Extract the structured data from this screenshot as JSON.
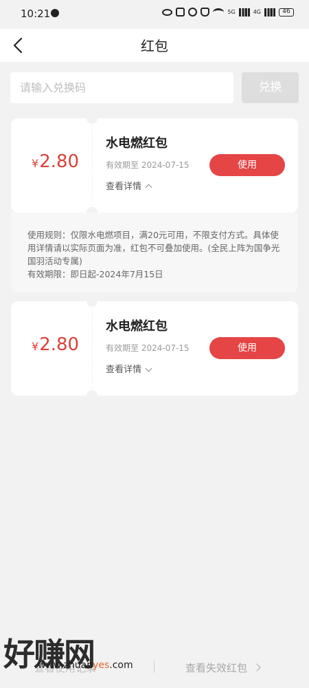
{
  "status_bar": {
    "time": "10:21",
    "network_1": "5G",
    "network_2": "4G",
    "battery": "46"
  },
  "nav": {
    "title": "红包"
  },
  "redeem": {
    "placeholder": "请输入兑换码",
    "button_label": "兑换"
  },
  "coupons": [
    {
      "currency": "¥",
      "amount": "2.80",
      "title": "水电燃红包",
      "expiry": "有效期至 2024-07-15",
      "details_label": "查看详情",
      "use_label": "使用",
      "expanded": true
    },
    {
      "currency": "¥",
      "amount": "2.80",
      "title": "水电燃红包",
      "expiry": "有效期至 2024-07-15",
      "details_label": "查看详情",
      "use_label": "使用",
      "expanded": false
    }
  ],
  "rules": {
    "text": "使用规则：仅限水电燃项目，满20元可用，不限支付方式。具体使用详情请以实际页面为准，红包不可叠加使用。(全民上阵为国争光国羽活动专属)",
    "validity": "有效期限：即日起-2024年7月15日"
  },
  "bottom": {
    "history_label": "查看使用记录",
    "expired_label": "查看失效红包"
  },
  "watermark": {
    "big_text": "好赚网",
    "url_prefix": "www.zhuan",
    "url_accent": "yes",
    "url_suffix": ".com"
  },
  "colors": {
    "accent": "#e54545",
    "amount": "#d9423a",
    "background": "#f2f2f2"
  }
}
